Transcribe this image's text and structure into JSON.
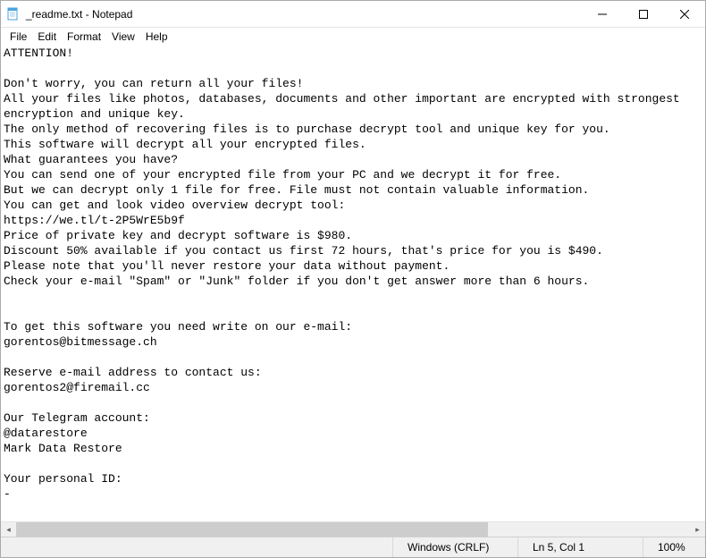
{
  "window": {
    "title": "_readme.txt - Notepad"
  },
  "menu": {
    "file": "File",
    "edit": "Edit",
    "format": "Format",
    "view": "View",
    "help": "Help"
  },
  "document": {
    "text": "ATTENTION!\n\nDon't worry, you can return all your files!\nAll your files like photos, databases, documents and other important are encrypted with strongest encryption and unique key.\nThe only method of recovering files is to purchase decrypt tool and unique key for you.\nThis software will decrypt all your encrypted files.\nWhat guarantees you have?\nYou can send one of your encrypted file from your PC and we decrypt it for free.\nBut we can decrypt only 1 file for free. File must not contain valuable information.\nYou can get and look video overview decrypt tool:\nhttps://we.tl/t-2P5WrE5b9f\nPrice of private key and decrypt software is $980.\nDiscount 50% available if you contact us first 72 hours, that's price for you is $490.\nPlease note that you'll never restore your data without payment.\nCheck your e-mail \"Spam\" or \"Junk\" folder if you don't get answer more than 6 hours.\n\n\nTo get this software you need write on our e-mail:\ngorentos@bitmessage.ch\n\nReserve e-mail address to contact us:\ngorentos2@firemail.cc\n\nOur Telegram account:\n@datarestore\nMark Data Restore\n\nYour personal ID:\n-"
  },
  "status": {
    "encoding": "Windows (CRLF)",
    "position": "Ln 5, Col 1",
    "zoom": "100%"
  }
}
